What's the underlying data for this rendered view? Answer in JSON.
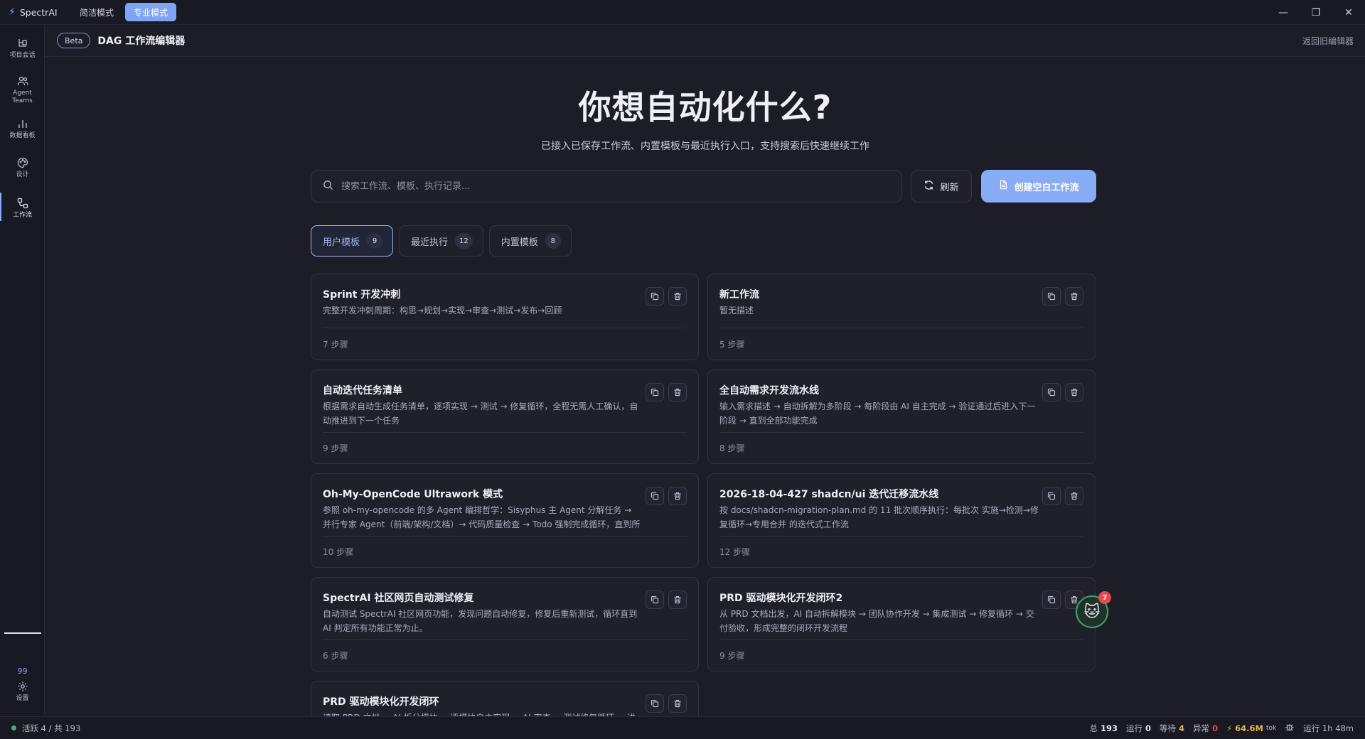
{
  "app": {
    "name": "SpectrAI",
    "modes": [
      "简洁模式",
      "专业模式"
    ],
    "active_mode": "专业模式"
  },
  "window_controls": {
    "minimize": "—",
    "restore": "❐",
    "close": "✕"
  },
  "sidebar": {
    "items": [
      {
        "label": "项目会话",
        "icon": "project-sessions-icon"
      },
      {
        "label": "Agent Teams",
        "icon": "agent-teams-icon"
      },
      {
        "label": "数据看板",
        "icon": "dashboard-icon"
      },
      {
        "label": "设计",
        "icon": "palette-icon"
      },
      {
        "label": "工作流",
        "icon": "workflow-icon",
        "active": true
      }
    ],
    "count": "99",
    "settings_label": "设置"
  },
  "header": {
    "badge": "Beta",
    "title": "DAG 工作流编辑器",
    "back_link": "返回旧编辑器"
  },
  "hero": {
    "title": "你想自动化什么?",
    "subtitle": "已接入已保存工作流、内置模板与最近执行入口，支持搜索后快速继续工作"
  },
  "search": {
    "placeholder": "搜索工作流、模板、执行记录..."
  },
  "buttons": {
    "refresh": "刷新",
    "create": "创建空白工作流"
  },
  "tabs": [
    {
      "label": "用户模板",
      "count": "9",
      "active": true
    },
    {
      "label": "最近执行",
      "count": "12"
    },
    {
      "label": "内置模板",
      "count": "8"
    }
  ],
  "cards": [
    {
      "title": "Sprint 开发冲刺",
      "desc": "完整开发冲刺周期：构思→规划→实现→审查→测试→发布→回顾",
      "steps": "7 步骤"
    },
    {
      "title": "新工作流",
      "desc": "暂无描述",
      "steps": "5 步骤"
    },
    {
      "title": "自动迭代任务清单",
      "desc": "根据需求自动生成任务清单，逐项实现 → 测试 → 修复循环，全程无需人工确认，自动推进到下一个任务",
      "steps": "9 步骤"
    },
    {
      "title": "全自动需求开发流水线",
      "desc": "输入需求描述 → 自动拆解为多阶段 → 每阶段由 AI 自主完成 → 验证通过后进入下一阶段 → 直到全部功能完成",
      "steps": "8 步骤"
    },
    {
      "title": "Oh-My-OpenCode Ultrawork 模式",
      "desc": "参照 oh-my-opencode 的多 Agent 编排哲学：Sisyphus 主 Agent 分解任务 → 并行专家 Agent（前端/架构/文档）→ 代码质量检查 → Todo 强制完成循环，直到所有...",
      "steps": "10 步骤"
    },
    {
      "title": "2026-18-04-427 shadcn/ui 迭代迁移流水线",
      "desc": "按 docs/shadcn-migration-plan.md 的 11 批次顺序执行：每批次 实施→检测→修复循环→专用合并 的迭代式工作流",
      "steps": "12 步骤"
    },
    {
      "title": "SpectrAI 社区网页自动测试修复",
      "desc": "自动测试 SpectrAI 社区网页功能，发现问题自动修复，修复后重新测试，循环直到 AI 判定所有功能正常为止。",
      "steps": "6 步骤"
    },
    {
      "title": "PRD 驱动模块化开发闭环2",
      "desc": "从 PRD 文档出发，AI 自动拆解模块 → 团队协作开发 → 集成测试 → 修复循环 → 交付验收，形成完整的闭环开发流程",
      "steps": "9 步骤"
    },
    {
      "title": "PRD 驱动模块化开发闭环",
      "desc": "读取 PRD 文档 → AI 拆分模块 → 逐模块自主实现 → AI 审查 → 测试修复循环 → 进度",
      "steps": ""
    }
  ],
  "mascot": {
    "icon": "cat-face-icon",
    "glyph": "🐱",
    "badge": "7"
  },
  "status": {
    "active": "活跃 4 / 共 193",
    "total_label": "总",
    "total": "193",
    "running_label": "运行",
    "running": "0",
    "waiting_label": "等待",
    "waiting": "4",
    "error_label": "异常",
    "error": "0",
    "tokens": "64.6M",
    "tokens_unit": "tok",
    "uptime": "运行 1h 48m"
  },
  "colors": {
    "accent": "#88acf5",
    "background": "#1c1d27",
    "card": "#1f2029"
  }
}
